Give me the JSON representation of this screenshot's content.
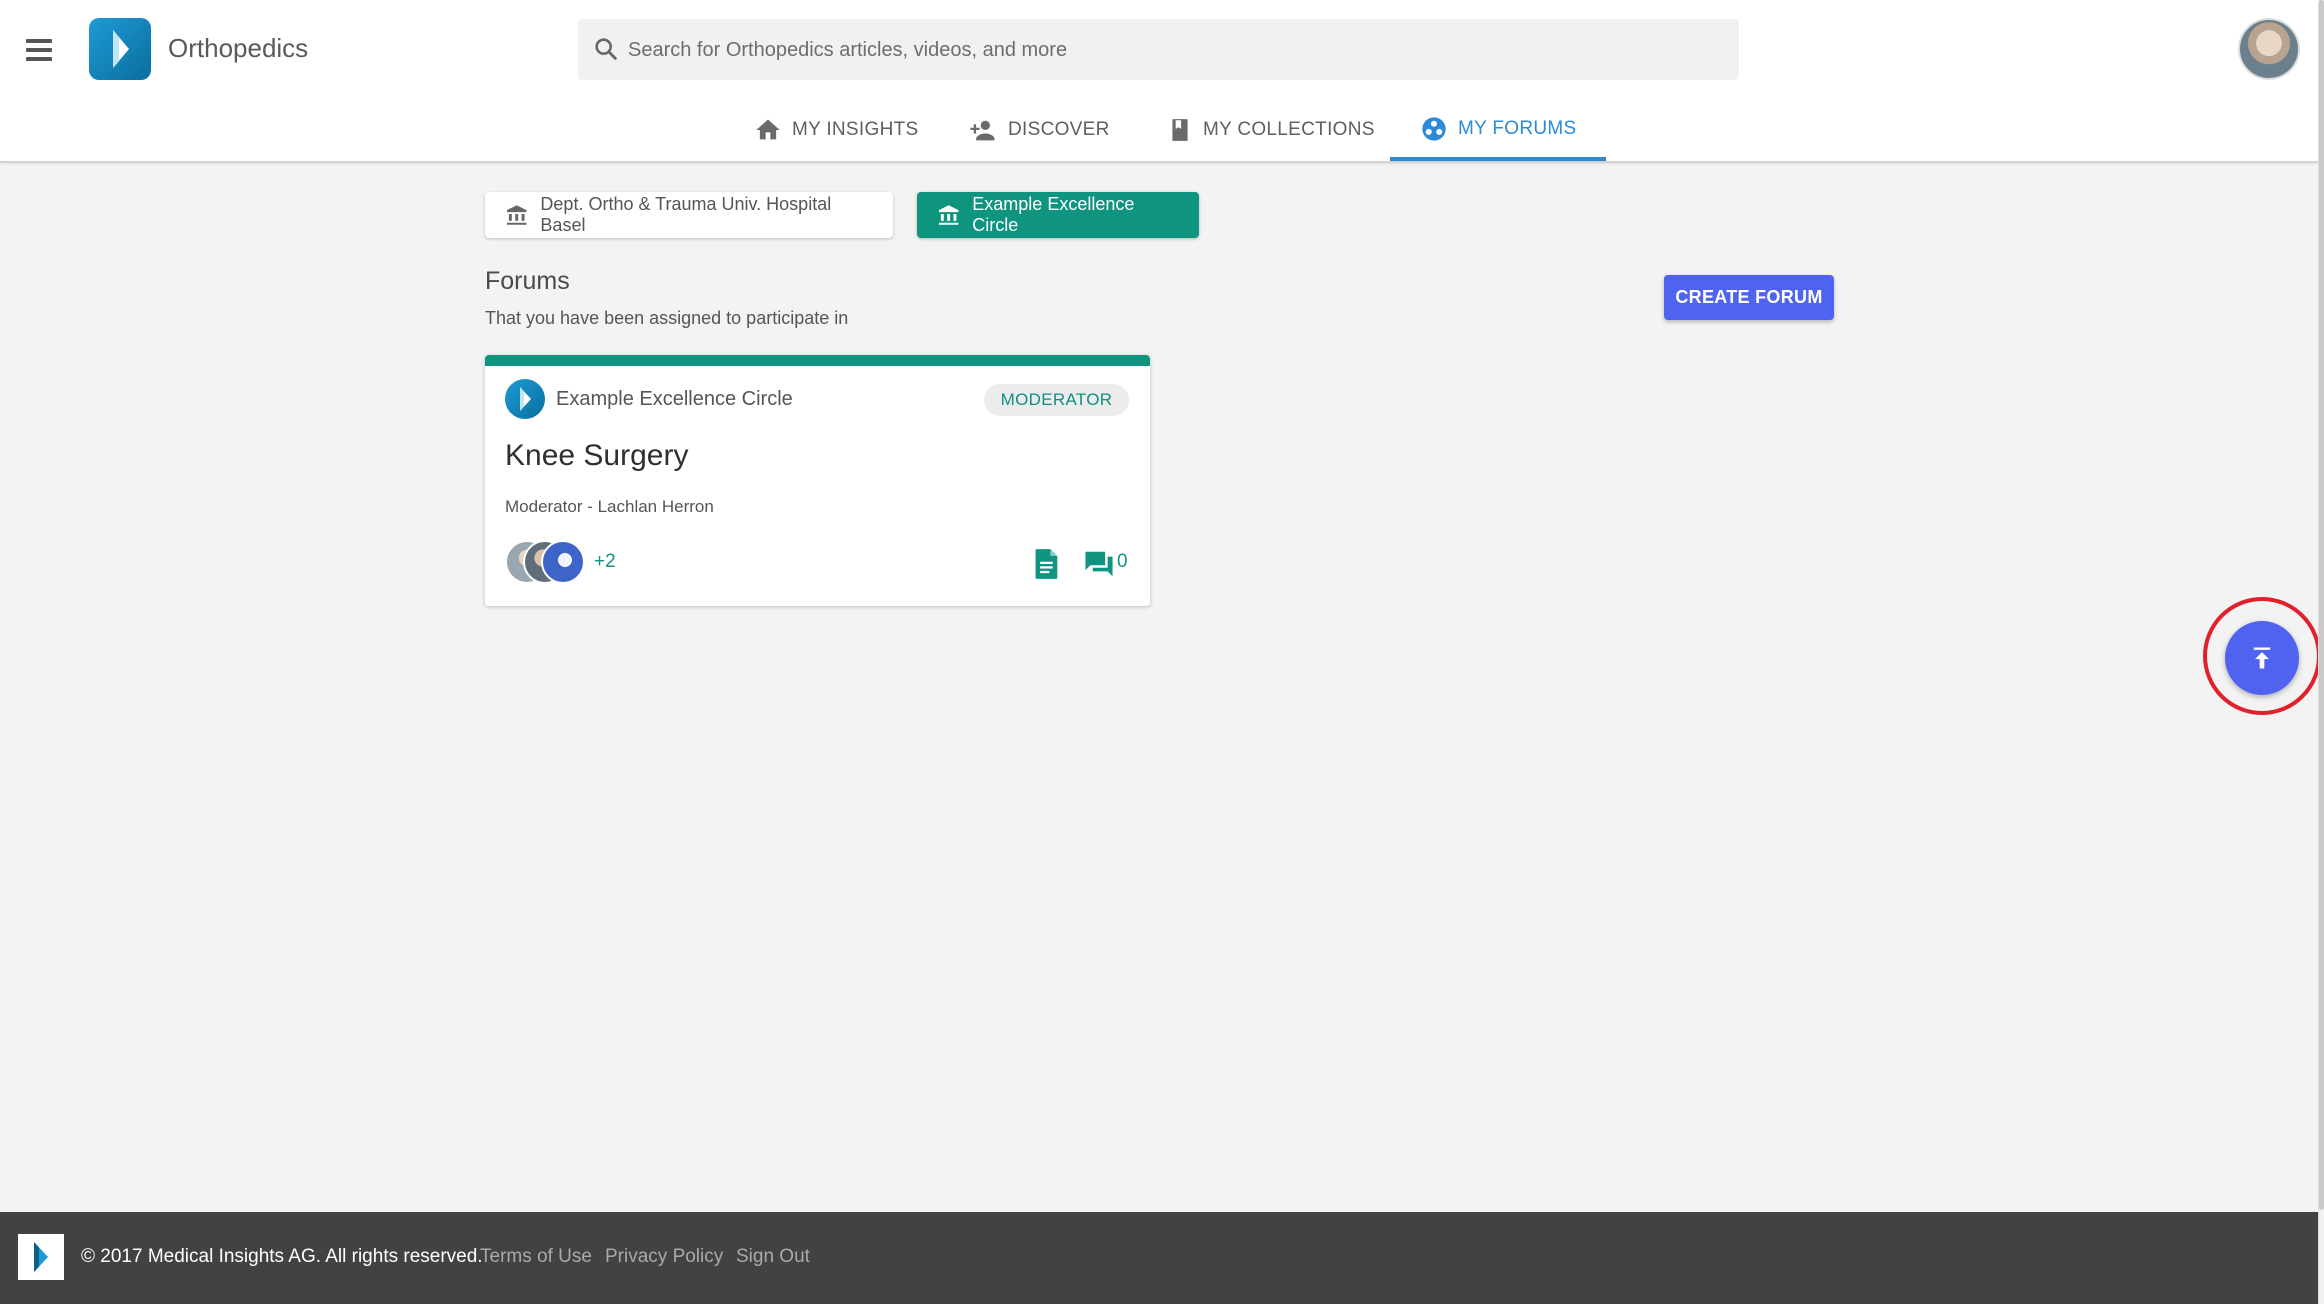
{
  "header": {
    "app_title": "Orthopedics",
    "search_placeholder": "Search for Orthopedics articles, videos, and more"
  },
  "tabs": [
    {
      "label": "MY INSIGHTS",
      "icon": "home-icon"
    },
    {
      "label": "DISCOVER",
      "icon": "person-add-icon"
    },
    {
      "label": "MY COLLECTIONS",
      "icon": "bookmark-icon"
    },
    {
      "label": "MY FORUMS",
      "icon": "group-icon",
      "active": true
    }
  ],
  "organizations": [
    {
      "label": "Dept. Ortho & Trauma Univ. Hospital Basel",
      "icon": "institution-icon",
      "selected": false
    },
    {
      "label": "Example Excellence Circle",
      "icon": "institution-icon",
      "selected": true
    }
  ],
  "forums": {
    "title": "Forums",
    "subtitle": "That you have been assigned to participate in",
    "create_label": "CREATE FORUM",
    "cards": [
      {
        "org": "Example Excellence Circle",
        "role": "MODERATOR",
        "title": "Knee Surgery",
        "moderator": "Moderator - Lachlan Herron",
        "more_members": "+2",
        "comment_count": "0"
      }
    ]
  },
  "footer": {
    "copyright": "© 2017 Medical Insights AG. All rights reserved.",
    "links": [
      "Terms of Use",
      "Privacy Policy",
      "Sign Out"
    ]
  },
  "colors": {
    "accent_blue": "#2b8ad8",
    "teal": "#0f9480",
    "button_blue": "#4f63f0",
    "highlight_ring": "#e0202a",
    "footer_bg": "#424242"
  }
}
